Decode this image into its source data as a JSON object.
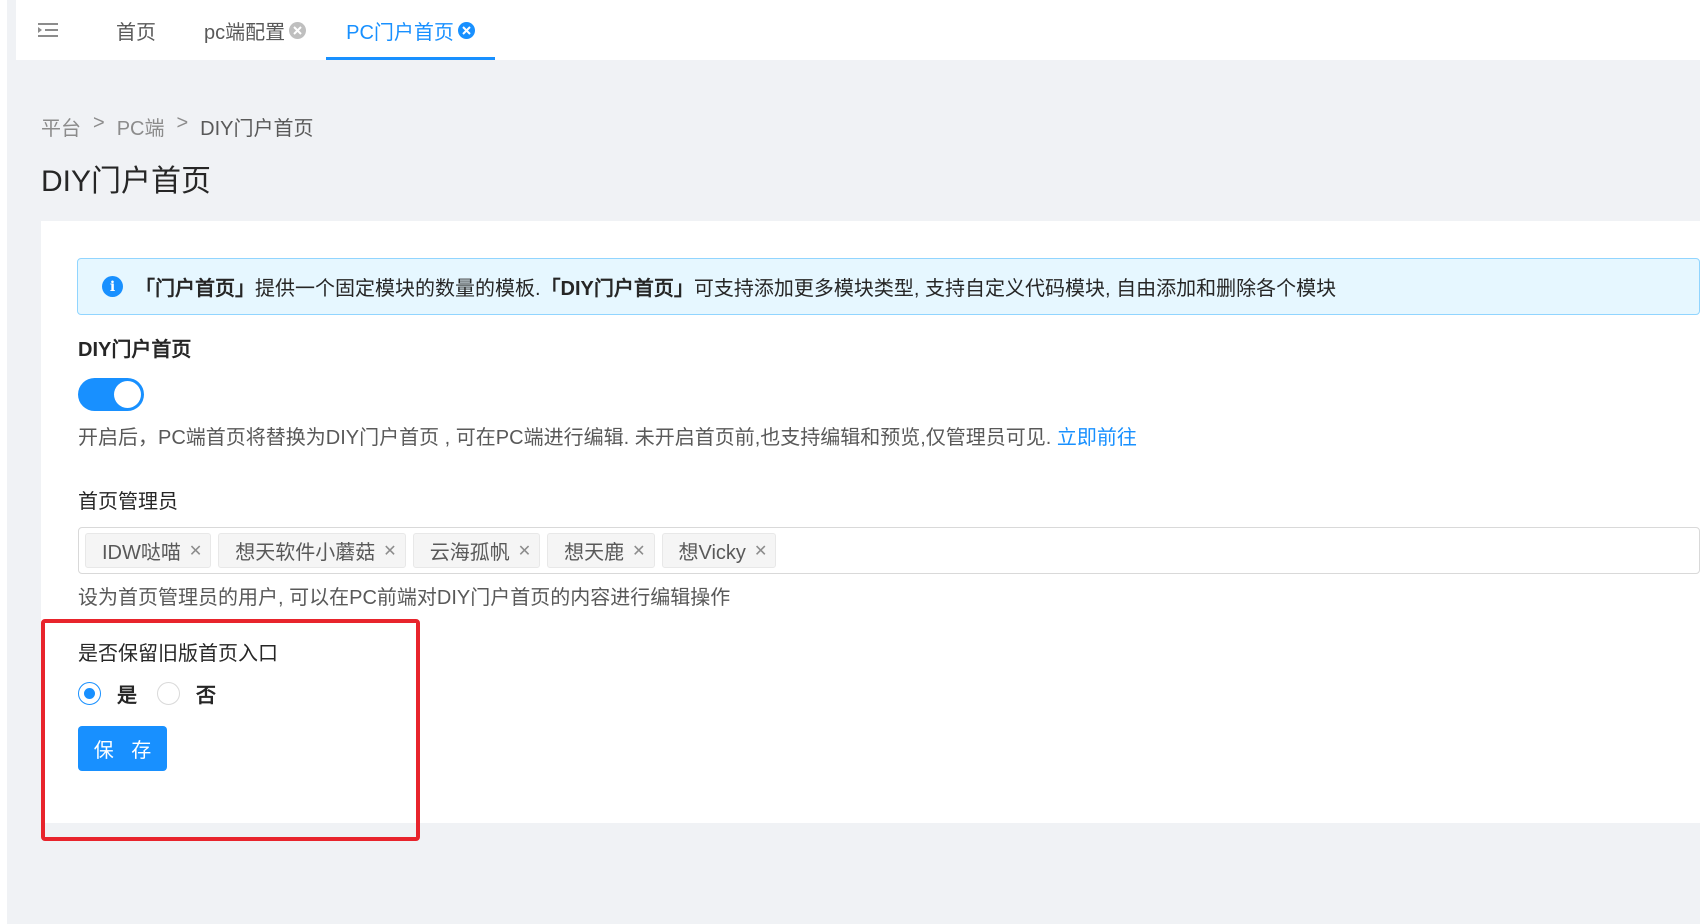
{
  "tabs": [
    {
      "label": "首页",
      "closable": false,
      "active": false
    },
    {
      "label": "pc端配置",
      "closable": true,
      "active": false
    },
    {
      "label": "PC门户首页",
      "closable": true,
      "active": true
    }
  ],
  "breadcrumb": {
    "items": [
      "平台",
      "PC端",
      "DIY门户首页"
    ],
    "separator": ">"
  },
  "page_title": "DIY门户首页",
  "alert": {
    "part1_bold": "「门户首页」",
    "part2": "提供一个固定模块的数量的模板.",
    "part3_bold": "「DIY门户首页」",
    "part4": "可支持添加更多模块类型, 支持自定义代码模块, 自由添加和删除各个模块"
  },
  "diy_section": {
    "label": "DIY门户首页",
    "switch_on": true,
    "description": "开启后，PC端首页将替换为DIY门户首页 , 可在PC端进行编辑. 未开启首页前,也支持编辑和预览,仅管理员可见.",
    "link_text": "立即前往"
  },
  "admin_section": {
    "label": "首页管理员",
    "tags": [
      "IDW哒喵",
      "想天软件小蘑菇",
      "云海孤帆",
      "想天鹿",
      "想Vicky"
    ],
    "hint": "设为首页管理员的用户, 可以在PC前端对DIY门户首页的内容进行编辑操作"
  },
  "keep_section": {
    "label": "是否保留旧版首页入口",
    "options": [
      "是",
      "否"
    ],
    "selected": "是"
  },
  "save_label": "保 存",
  "colors": {
    "primary": "#1890ff",
    "highlight": "#e8242c",
    "alert_bg": "#e6f7ff"
  }
}
